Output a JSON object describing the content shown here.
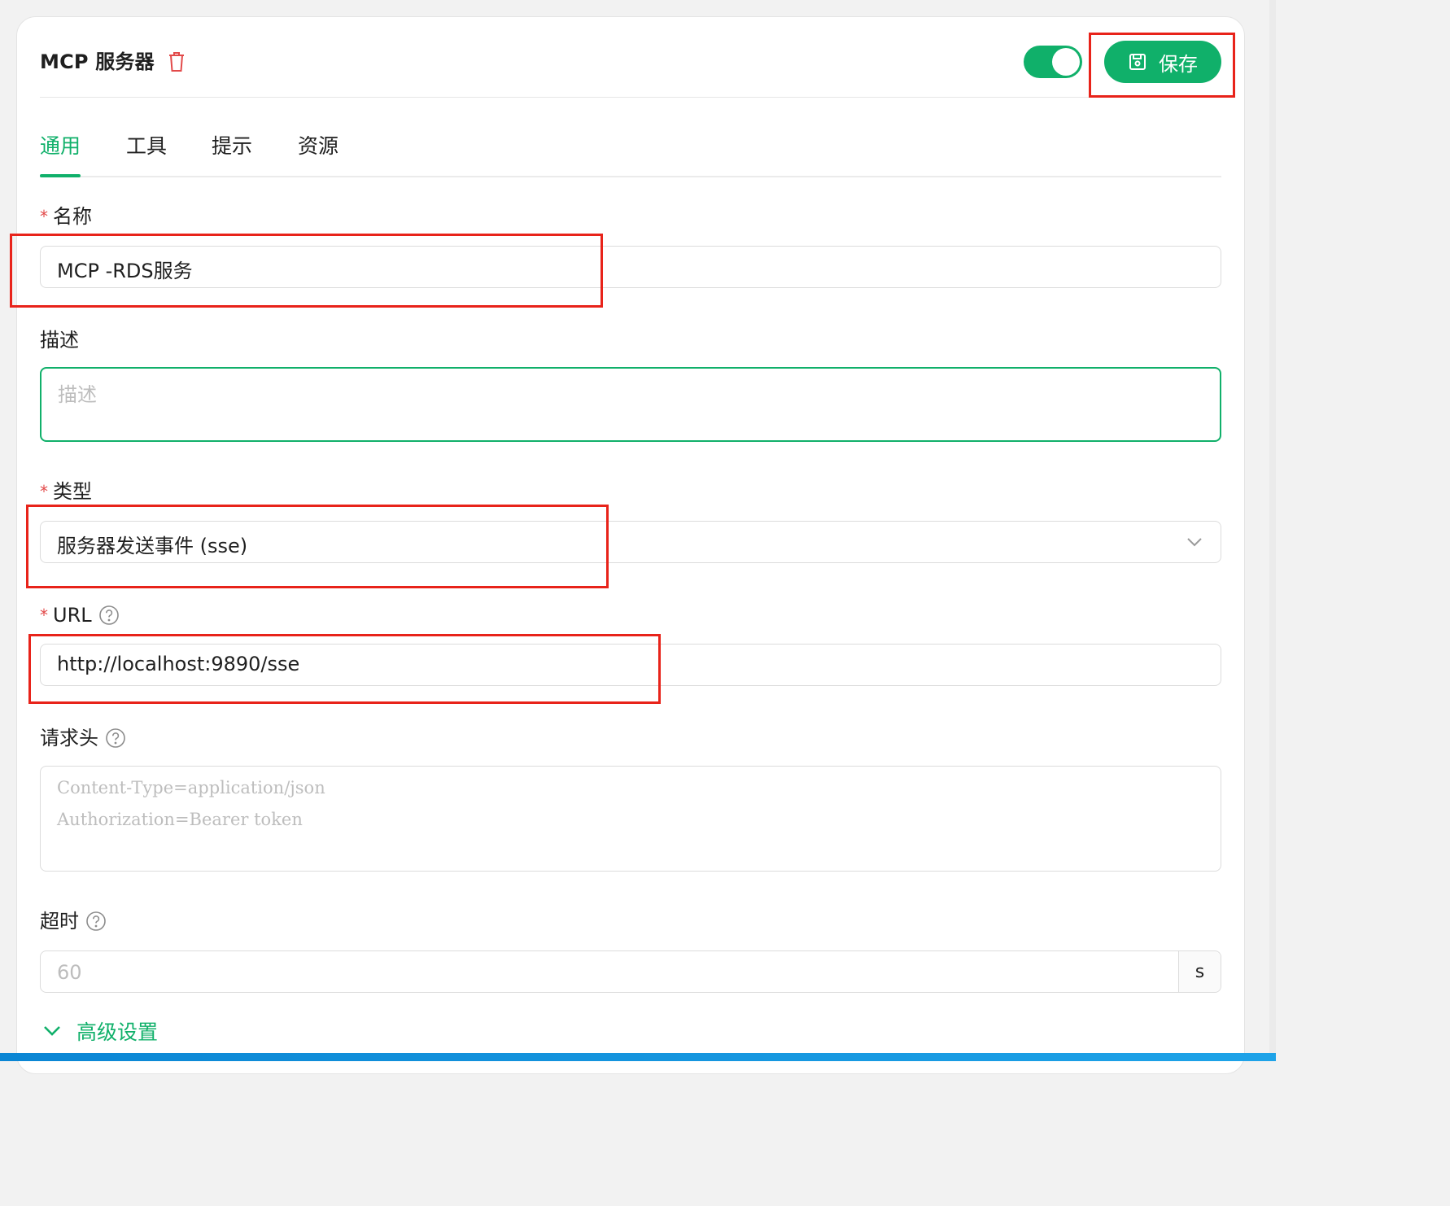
{
  "header": {
    "title": "MCP 服务器",
    "save_label": "保存",
    "enabled": true
  },
  "tabs": [
    {
      "label": "通用",
      "active": true
    },
    {
      "label": "工具",
      "active": false
    },
    {
      "label": "提示",
      "active": false
    },
    {
      "label": "资源",
      "active": false
    }
  ],
  "form": {
    "name": {
      "label": "名称",
      "required": "*",
      "value": "MCP -RDS服务"
    },
    "description": {
      "label": "描述",
      "placeholder": "描述"
    },
    "type": {
      "label": "类型",
      "required": "*",
      "value": "服务器发送事件 (sse)"
    },
    "url": {
      "label": "URL",
      "required": "*",
      "value": "http://localhost:9890/sse"
    },
    "headers": {
      "label": "请求头",
      "placeholder_line1": "Content-Type=application/json",
      "placeholder_line2": "Authorization=Bearer token"
    },
    "timeout": {
      "label": "超时",
      "placeholder": "60",
      "unit": "s"
    }
  },
  "advanced": {
    "label": "高级设置"
  },
  "colors": {
    "accent": "#10b06a",
    "required": "#e24a4a",
    "annotation": "#e8231a",
    "bottom_bar": "#0b86d4"
  },
  "icons": {
    "trash": "trash-icon",
    "save": "floppy-disk-icon",
    "help": "question-circle-icon",
    "dropdown": "chevron-down-icon",
    "advanced": "chevron-down-icon"
  }
}
